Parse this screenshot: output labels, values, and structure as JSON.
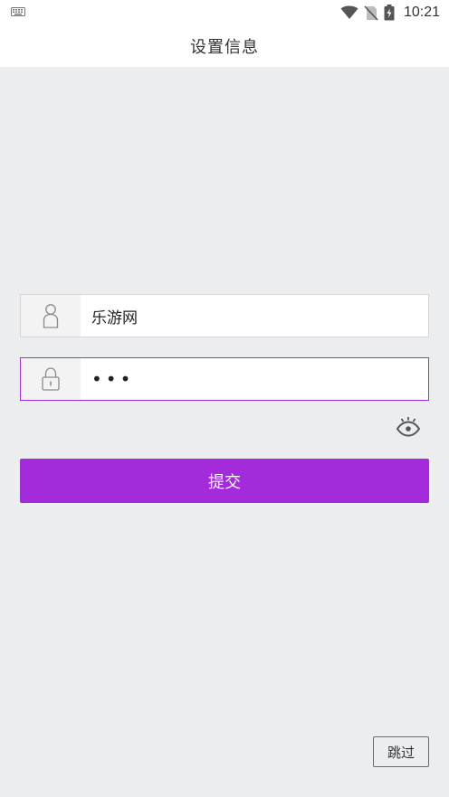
{
  "status_bar": {
    "time": "10:21",
    "icons": [
      "keyboard-icon",
      "wifi-icon",
      "no-sim-icon",
      "battery-charging-icon"
    ]
  },
  "header": {
    "title": "设置信息"
  },
  "form": {
    "username": {
      "icon": "user-icon",
      "value": "乐游网"
    },
    "password": {
      "icon": "lock-icon",
      "masked_value": "•••"
    },
    "visibility_icon": "eye-icon",
    "submit_label": "提交"
  },
  "skip_label": "跳过",
  "colors": {
    "accent": "#a32bdc",
    "background": "#ecedef",
    "bar_background": "#ffffff"
  }
}
